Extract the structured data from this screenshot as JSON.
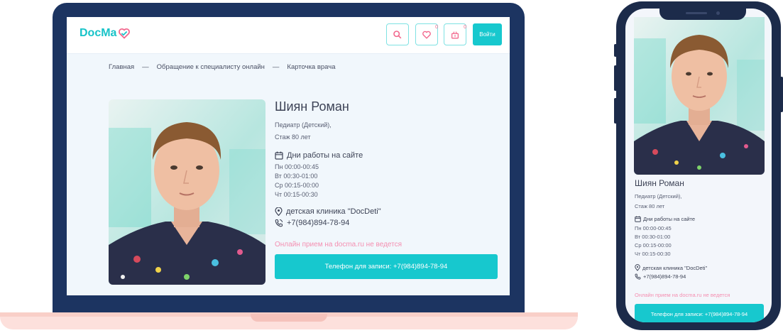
{
  "header": {
    "logo_text": "DocMa",
    "login_label": "Войти",
    "favorites_count": "0",
    "cart_count": "0"
  },
  "breadcrumb": {
    "items": [
      "Главная",
      "Обращение к специалисту онлайн",
      "Карточка врача"
    ],
    "separator": "—"
  },
  "doctor": {
    "name": "Шиян Роман",
    "specialty": "Педиатр (Детский),",
    "experience": "Стаж 80 лет",
    "days_heading": "Дни работы на сайте",
    "schedule": [
      "Пн 00:00-00:45",
      "Вт 00:30-01:00",
      "Ср 00:15-00:00",
      "Чт 00:15-00:30"
    ],
    "clinic": "детская клиника \"DocDeti\"",
    "phone": "+7(984)894-78-94",
    "online_note": "Онлайн прием на docma.ru не ведется",
    "phone_button_label": "Телефон для записи: +7(984)894-78-94"
  },
  "icons": {
    "search": "search-icon",
    "favorites": "heart-icon",
    "cart": "basket-icon",
    "calendar": "calendar-icon",
    "location": "location-pin-icon",
    "phone": "phone-icon"
  },
  "colors": {
    "accent": "#17c8ce",
    "pink": "#f48fb1",
    "laptop_frame": "#1c3461",
    "phone_frame": "#1c2b4a"
  }
}
